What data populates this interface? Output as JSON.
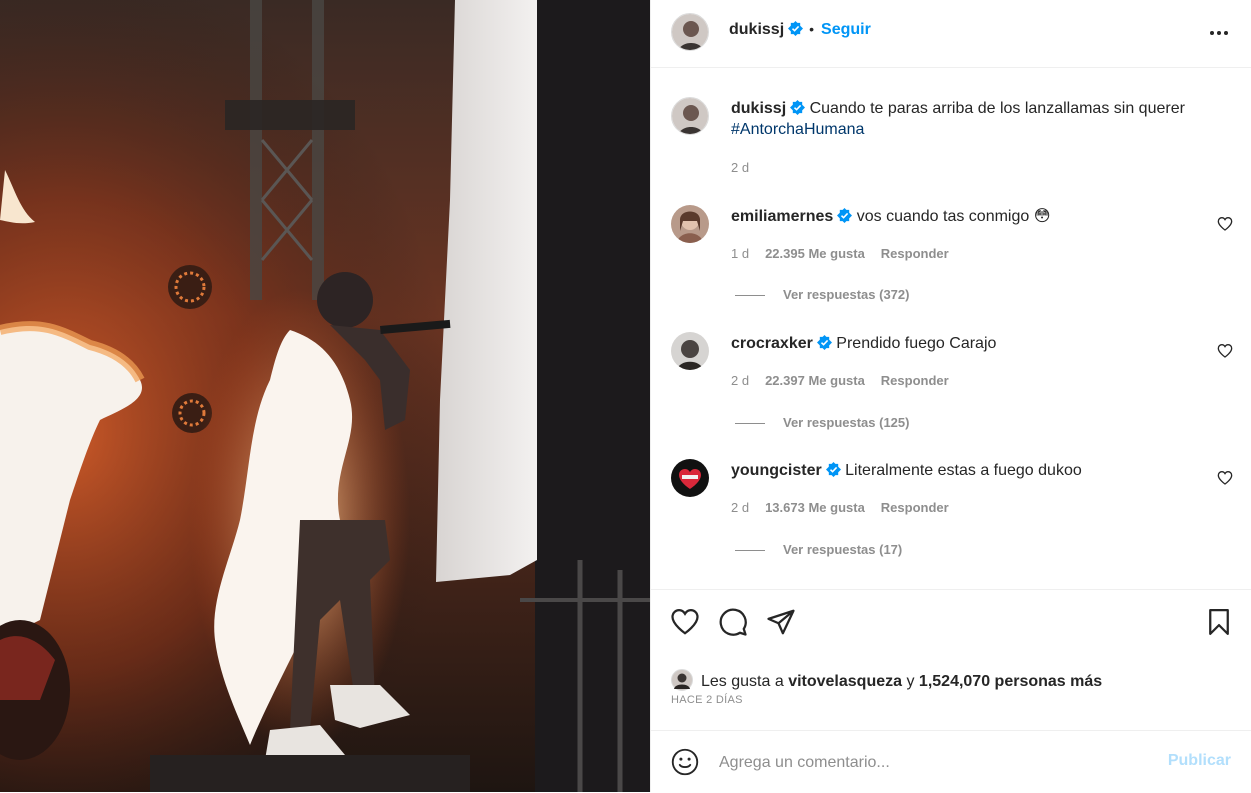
{
  "colors": {
    "accent": "#0095f6",
    "muted": "#8e8e8e",
    "text": "#262626",
    "hashtag": "#00376b",
    "publish_disabled": "#b2dffc"
  },
  "post": {
    "author": "dukissj",
    "verified": true,
    "follow_label": "Seguir",
    "separator": "•",
    "more_icon": "more-horizontal-icon"
  },
  "caption": {
    "username": "dukissj",
    "text": "Cuando te paras arriba de los lanzallamas sin querer",
    "hashtag": "#AntorchaHumana",
    "time": "2 d"
  },
  "comments": [
    {
      "username": "emiliamernes",
      "text": "vos cuando tas conmigo 😳",
      "time": "1 d",
      "likes": "22.395 Me gusta",
      "reply_label": "Responder",
      "view_replies": "Ver respuestas (372)"
    },
    {
      "username": "crocraxker",
      "text": "Prendido fuego Carajo",
      "time": "2 d",
      "likes": "22.397 Me gusta",
      "reply_label": "Responder",
      "view_replies": "Ver respuestas (125)"
    },
    {
      "username": "youngcister",
      "text": "Literalmente estas a fuego dukoo",
      "time": "2 d",
      "likes": "13.673 Me gusta",
      "reply_label": "Responder",
      "view_replies": "Ver respuestas (17)"
    }
  ],
  "likes": {
    "prefix": "Les gusta a",
    "user": "vitovelasqueza",
    "conj": "y",
    "count": "1,524,070 personas más"
  },
  "date_label": "HACE 2 DÍAS",
  "add_comment": {
    "placeholder": "Agrega un comentario...",
    "publish_label": "Publicar"
  }
}
